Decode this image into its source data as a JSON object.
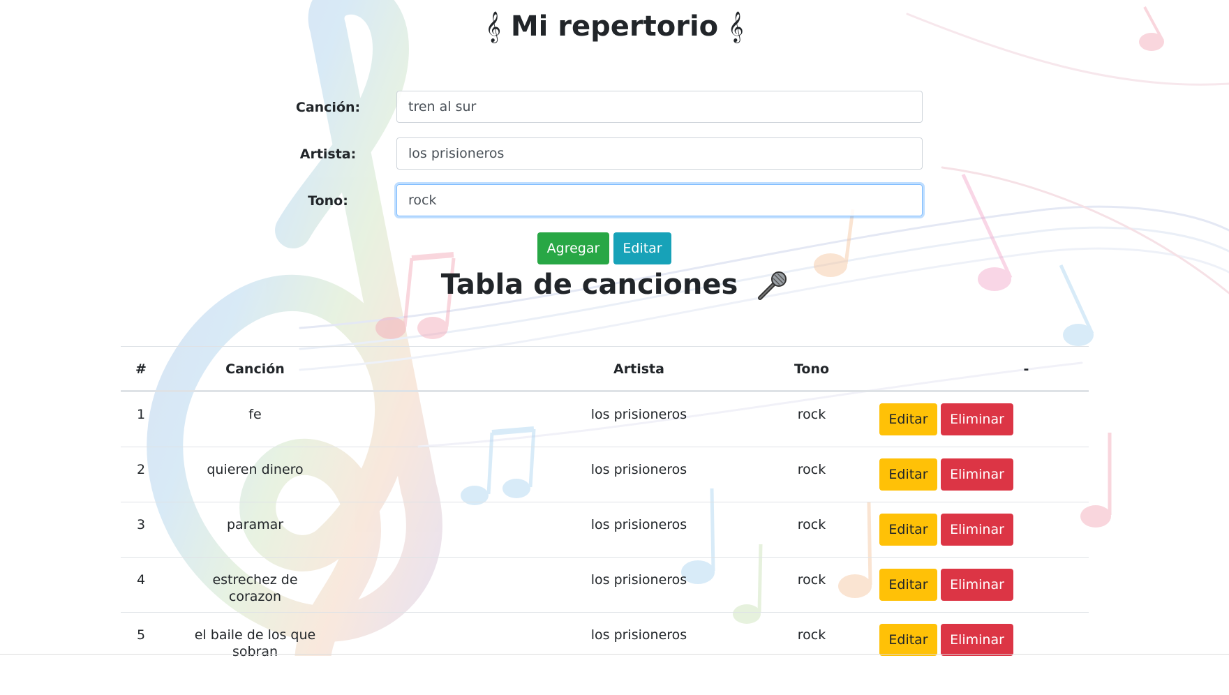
{
  "header": {
    "title": "Mi repertorio",
    "clef_glyph": "𝄞"
  },
  "form": {
    "fields": [
      {
        "label": "Canción:",
        "value": "tren al sur"
      },
      {
        "label": "Artista:",
        "value": "los prisioneros"
      },
      {
        "label": "Tono:",
        "value": "rock"
      }
    ],
    "add_label": "Agregar",
    "edit_label": "Editar"
  },
  "table": {
    "title": "Tabla de canciones",
    "title_icon": "microphone-icon",
    "columns": [
      "#",
      "Canción",
      "Artista",
      "Tono",
      "-"
    ],
    "rows": [
      {
        "num": "1",
        "song": "fe",
        "artist": "los prisioneros",
        "tono": "rock"
      },
      {
        "num": "2",
        "song": "quieren dinero",
        "artist": "los prisioneros",
        "tono": "rock"
      },
      {
        "num": "3",
        "song": "paramar",
        "artist": "los prisioneros",
        "tono": "rock"
      },
      {
        "num": "4",
        "song": "estrechez de corazon",
        "artist": "los prisioneros",
        "tono": "rock"
      },
      {
        "num": "5",
        "song": "el baile de los que sobran",
        "artist": "los prisioneros",
        "tono": "rock"
      }
    ],
    "edit_label": "Editar",
    "delete_label": "Eliminar"
  },
  "colors": {
    "success": "#28a745",
    "info": "#17a2b8",
    "warning": "#ffc107",
    "danger": "#dc3545"
  }
}
